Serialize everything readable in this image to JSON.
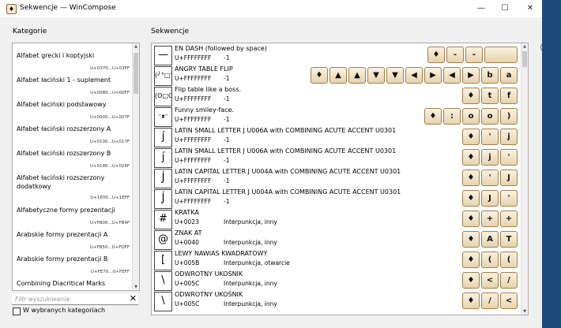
{
  "window": {
    "title": "Sekwencje — WinCompose",
    "app_icon": "♦",
    "minimize": "—",
    "maximize": "☐",
    "close": "✕"
  },
  "categories_panel": {
    "label": "Kategorie",
    "items": [
      {
        "name": "Alfabet grecki i koptyjski",
        "range": "U+0370...U+03FF"
      },
      {
        "name": "Alfabet łaciński 1 - suplement",
        "range": "U+0080...U+00FF"
      },
      {
        "name": "Alfabet łaciński podstawowy",
        "range": "U+0000...U+007F"
      },
      {
        "name": "Alfabet łaciński rozszerzony A",
        "range": "U+0100...U+017F"
      },
      {
        "name": "Alfabet łaciński rozszerzony B",
        "range": "U+0180...U+024F"
      },
      {
        "name": "Alfabet łaciński rozszerzony dodatkowy",
        "range": "U+1E00...U+1EFF"
      },
      {
        "name": "Alfabetyczne formy prezentacji",
        "range": "U+FB00...U+FB4F"
      },
      {
        "name": "Arabskie formy prezentacji A",
        "range": "U+FB50...U+FDFF"
      },
      {
        "name": "Arabskie formy prezentacji B",
        "range": "U+FE70...U+FEFF"
      },
      {
        "name": "Combining Diacritical Marks",
        "range": ""
      }
    ],
    "search_placeholder": "Filtr wyszukiwania:",
    "clear_icon": "✕",
    "checkbox_label": "W wybranych kategoriach"
  },
  "sequences_panel": {
    "label": "Sekwencje",
    "collapse_icon": "‹",
    "rows": [
      {
        "glyph": "—",
        "name": "EN DASH (followed by space)",
        "code": "U+FFFFFFFF",
        "cat": "-1",
        "keys": [
          "♦",
          "-",
          "-",
          " "
        ]
      },
      {
        "glyph": "(╯°□°",
        "name": "ANGRY TABLE FLIP",
        "code": "U+FFFFFFFF",
        "cat": "-1",
        "keys": [
          "♦",
          "▲",
          "▲",
          "▼",
          "▼",
          "◀",
          "▶",
          "◀",
          "▶",
          "b",
          "a"
        ]
      },
      {
        "glyph": "(ʘ□ʘ",
        "name": "Flip table like a boss.",
        "code": "U+FFFFFFFF",
        "cat": "-1",
        "keys": [
          "♦",
          "t",
          "f"
        ]
      },
      {
        "glyph": "ᵔᴥᵔ",
        "name": "Funny smiley-face.",
        "code": "U+FFFFFFFF",
        "cat": "-1",
        "keys": [
          "♦",
          ":",
          "o",
          "o",
          ")"
        ]
      },
      {
        "glyph": "ȷ́",
        "name": "LATIN SMALL LETTER J U006A with COMBINING ACUTE ACCENT U0301",
        "code": "U+FFFFFFFF",
        "cat": "-1",
        "keys": [
          "♦",
          "'",
          "j"
        ]
      },
      {
        "glyph": "ȷ́",
        "name": "LATIN SMALL LETTER J U006A with COMBINING ACUTE ACCENT U0301",
        "code": "U+FFFFFFFF",
        "cat": "-1",
        "keys": [
          "♦",
          "j",
          "'"
        ]
      },
      {
        "glyph": "J́",
        "name": "LATIN CAPITAL LETTER J U004A with COMBINING ACUTE ACCENT U0301",
        "code": "U+FFFFFFFF",
        "cat": "-1",
        "keys": [
          "♦",
          "'",
          "J"
        ]
      },
      {
        "glyph": "J́",
        "name": "LATIN CAPITAL LETTER J U004A with COMBINING ACUTE ACCENT U0301",
        "code": "U+FFFFFFFF",
        "cat": "-1",
        "keys": [
          "♦",
          "J",
          "'"
        ]
      },
      {
        "glyph": "#",
        "name": "KRATKA",
        "code": "U+0023",
        "cat": "Interpunkcja, inny",
        "keys": [
          "♦",
          "+",
          "+"
        ]
      },
      {
        "glyph": "@",
        "name": "ZNAK AT",
        "code": "U+0040",
        "cat": "Interpunkcja, inny",
        "keys": [
          "♦",
          "A",
          "T"
        ]
      },
      {
        "glyph": "[",
        "name": "LEWY NAWIAS KWADRATOWY",
        "code": "U+005B",
        "cat": "Interpunkcja, otwarcie",
        "keys": [
          "♦",
          "(",
          "("
        ]
      },
      {
        "glyph": "\\",
        "name": "ODWROTNY UKOŚNIK",
        "code": "U+005C",
        "cat": "Interpunkcja, inny",
        "keys": [
          "♦",
          "<",
          "/"
        ]
      },
      {
        "glyph": "\\",
        "name": "ODWROTNY UKOŚNIK",
        "code": "U+005C",
        "cat": "Interpunkcja, inny",
        "keys": [
          "♦",
          "/",
          "<"
        ]
      }
    ]
  }
}
